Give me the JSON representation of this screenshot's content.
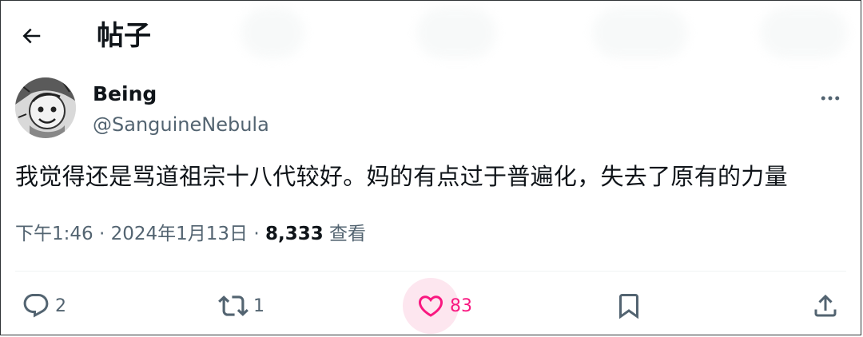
{
  "header": {
    "title": "帖子",
    "back_icon": "arrow-left-icon"
  },
  "author": {
    "display_name": "Being",
    "handle": "@SanguineNebula",
    "more_icon": "more-horizontal-icon"
  },
  "tweet": {
    "text": "我觉得还是骂道祖宗十八代较好。妈的有点过于普遍化，失去了原有的力量"
  },
  "meta": {
    "time": "下午1:46",
    "separator1": " · ",
    "date": "2024年1月13日",
    "separator2": " · ",
    "views_count": "8,333",
    "views_label": " 查看"
  },
  "actions": {
    "reply": {
      "icon": "reply-icon",
      "count": "2"
    },
    "retweet": {
      "icon": "retweet-icon",
      "count": "1"
    },
    "like": {
      "icon": "heart-icon",
      "count": "83",
      "color": "#f91880"
    },
    "bookmark": {
      "icon": "bookmark-icon"
    },
    "share": {
      "icon": "share-icon"
    }
  },
  "colors": {
    "text": "#0f1419",
    "secondary": "#536471",
    "like_accent": "#f91880",
    "border": "#2f3336"
  }
}
